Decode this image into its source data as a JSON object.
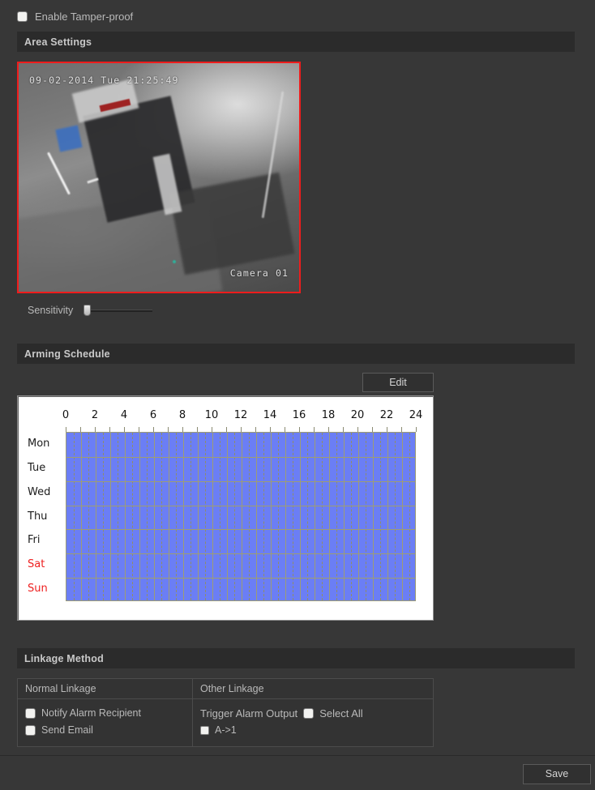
{
  "top": {
    "enable_tamper_label": "Enable Tamper-proof",
    "enable_tamper_checked": false
  },
  "sections": {
    "area_settings": "Area Settings",
    "arming_schedule": "Arming Schedule",
    "linkage_method": "Linkage Method"
  },
  "video": {
    "timestamp": "09-02-2014 Tue 21:25:49",
    "camera_name": "Camera 01",
    "border_color": "#ee1c1c"
  },
  "sensitivity": {
    "label": "Sensitivity",
    "value": 0
  },
  "arming": {
    "edit_label": "Edit",
    "hour_labels": [
      "0",
      "2",
      "4",
      "6",
      "8",
      "10",
      "12",
      "14",
      "16",
      "18",
      "20",
      "22",
      "24"
    ],
    "days": [
      {
        "label": "Mon",
        "weekend": false
      },
      {
        "label": "Tue",
        "weekend": false
      },
      {
        "label": "Wed",
        "weekend": false
      },
      {
        "label": "Thu",
        "weekend": false
      },
      {
        "label": "Fri",
        "weekend": false
      },
      {
        "label": "Sat",
        "weekend": true
      },
      {
        "label": "Sun",
        "weekend": true
      }
    ],
    "armed_color": "#6b7ef5",
    "grid_line_color": "#9d9d75",
    "ranges": [
      {
        "day": "Mon",
        "start": 0,
        "end": 24
      },
      {
        "day": "Tue",
        "start": 0,
        "end": 24
      },
      {
        "day": "Wed",
        "start": 0,
        "end": 24
      },
      {
        "day": "Thu",
        "start": 0,
        "end": 24
      },
      {
        "day": "Fri",
        "start": 0,
        "end": 24
      },
      {
        "day": "Sat",
        "start": 0,
        "end": 24
      },
      {
        "day": "Sun",
        "start": 0,
        "end": 24
      }
    ]
  },
  "linkage": {
    "normal_header": "Normal Linkage",
    "other_header": "Other Linkage",
    "normal_options": [
      {
        "label": "Notify Alarm Recipient",
        "checked": false
      },
      {
        "label": "Send Email",
        "checked": false
      }
    ],
    "other": {
      "trigger_label": "Trigger Alarm Output",
      "select_all_label": "Select All",
      "select_all_checked": false,
      "outputs": [
        {
          "label": "A->1",
          "checked": false
        }
      ]
    }
  },
  "footer": {
    "save_label": "Save"
  }
}
